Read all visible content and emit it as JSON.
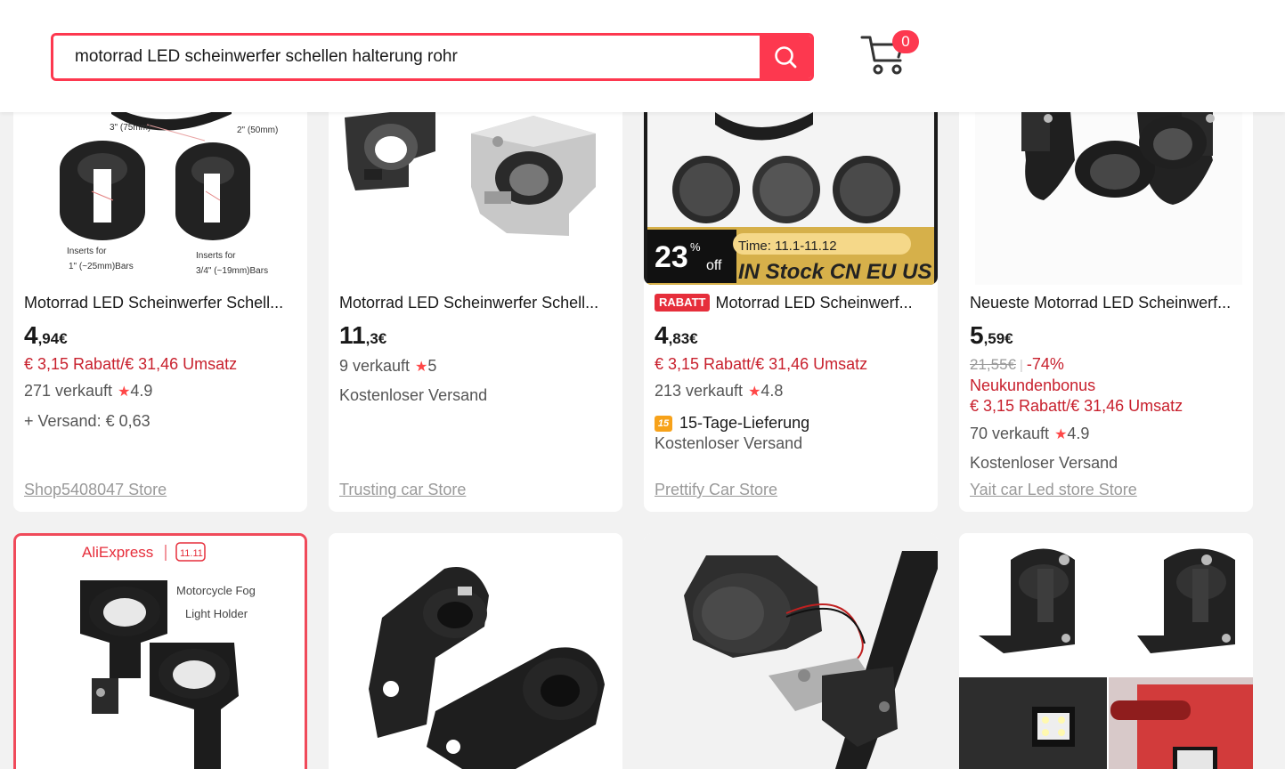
{
  "search": {
    "value": "motorrad LED scheinwerfer schellen halterung rohr",
    "button_icon": "search-icon"
  },
  "cart": {
    "icon": "cart-icon",
    "count": "0"
  },
  "products": [
    {
      "title": "Motorrad LED Scheinwerfer Schell...",
      "price_int": "4",
      "price_dec": ",94€",
      "discount": "€ 3,15 Rabatt/€ 31,46 Umsatz",
      "sold": "271 verkauft",
      "rating": "4.9",
      "shipping": "+ Versand: € 0,63",
      "store": "Shop5408047 Store",
      "image_labels": {
        "a": "3\" (75mm)",
        "b": "2\" (50mm)",
        "c": "Inserts for",
        "d": "1\" (~25mm)Bars",
        "e": "Inserts for",
        "f": "3/4\" (~19mm)Bars"
      }
    },
    {
      "title": "Motorrad LED Scheinwerfer Schell...",
      "price_int": "11",
      "price_dec": ",3€",
      "sold": "9 verkauft",
      "rating": "5",
      "shipping": "Kostenloser Versand",
      "store": "Trusting car Store"
    },
    {
      "badge": "RABATT",
      "title": "Motorrad LED Scheinwerf...",
      "price_int": "4",
      "price_dec": ",83€",
      "discount": "€ 3,15 Rabatt/€ 31,46 Umsatz",
      "sold": "213 verkauft",
      "rating": "4.8",
      "delivery": "15-Tage-Lieferung",
      "delivery_icon_text": "15",
      "shipping": "Kostenloser Versand",
      "store": "Prettify Car Store",
      "image_labels": {
        "pct": "23",
        "pct_unit": "%",
        "off": "off",
        "time": "Time: 11.1-11.12",
        "stock": "IN Stock CN EU US"
      }
    },
    {
      "title": "Neueste Motorrad LED Scheinwerf...",
      "price_int": "5",
      "price_dec": ",59€",
      "old_price": "21,55€",
      "percent": "-74%",
      "bonus": "Neukundenbonus",
      "discount": "€ 3,15 Rabatt/€ 31,46 Umsatz",
      "sold": "70 verkauft",
      "rating": "4.9",
      "shipping": "Kostenloser Versand",
      "store": "Yait car Led store Store"
    },
    {
      "image_labels": {
        "brand": "AliExpress",
        "event": "11.11",
        "caption1": "Motorcycle Fog",
        "caption2": "Light Holder"
      }
    },
    {},
    {},
    {}
  ],
  "colors": {
    "accent": "#fd384f",
    "discount_red": "#c8202d",
    "star": "#ff4747"
  }
}
